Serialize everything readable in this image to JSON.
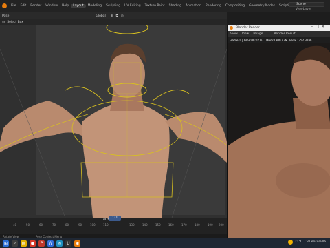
{
  "top_menu": {
    "workspaces": [
      "Layout",
      "Modeling",
      "Sculpting",
      "UV Editing",
      "Texture Paint",
      "Shading",
      "Animation",
      "Rendering",
      "Compositing",
      "Geometry Nodes",
      "Scripting"
    ],
    "active": "Layout",
    "scene": "Scene",
    "view_layer": "ViewLayer"
  },
  "viewport_header": {
    "mode": "Pose",
    "select_box": "Select Box",
    "orientation": "Global",
    "options": "Pose Options"
  },
  "render_window": {
    "title": "Blender Render",
    "menu": [
      "View",
      "View",
      "Image"
    ],
    "slot": "Render Result",
    "info": "Frame:1 | Time:00:02.07 | Mem:1809.47M (Peak 1752.31M)"
  },
  "timeline": {
    "ticks": [
      "40",
      "50",
      "60",
      "70",
      "80",
      "90",
      "100",
      "110",
      "120",
      "130",
      "140",
      "150",
      "160",
      "170",
      "180",
      "190",
      "200"
    ],
    "current_frame": "121"
  },
  "status_bar": {
    "left": "Rotate View",
    "mid": "Pose Context Menu"
  },
  "taskbar": {
    "weather_temp": "21°C",
    "weather_desc": "Ciel ensoleillé"
  },
  "colors": {
    "blender_orange": "#e87d0d",
    "rig_yellow": "#d8c020",
    "skin": "#b98a6e"
  }
}
